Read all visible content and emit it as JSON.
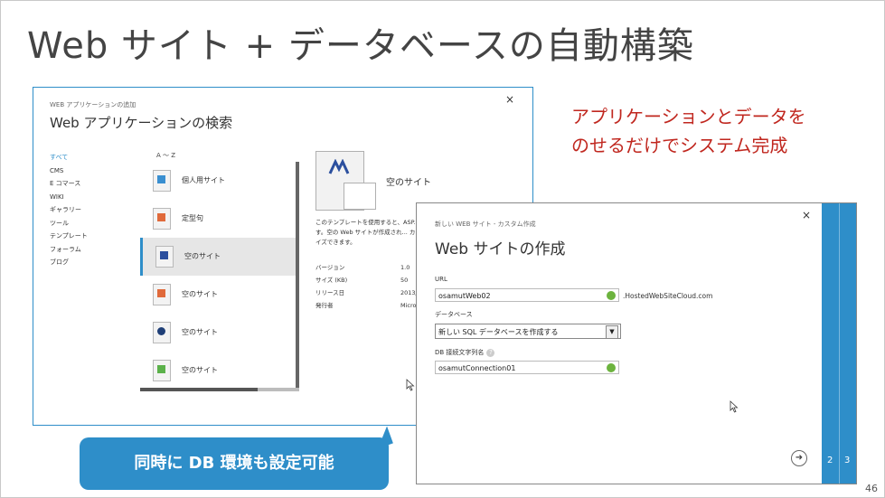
{
  "slide": {
    "title": "Web サイト + データベースの自動構築",
    "note_line1": "アプリケーションとデータを",
    "note_line2": "のせるだけでシステム完成",
    "callout": "同時に DB 環境も設定可能",
    "page_number": "46"
  },
  "gallery_dialog": {
    "close": "×",
    "breadcrumb": "WEB アプリケーションの追加",
    "title": "Web アプリケーションの検索",
    "categories": [
      "すべて",
      "CMS",
      "E コマース",
      "WIKI",
      "ギャラリー",
      "ツール",
      "テンプレート",
      "フォーラム",
      "ブログ"
    ],
    "az_label": "A ～ Z",
    "apps": [
      {
        "label": "個人用サイト"
      },
      {
        "label": "定型句"
      },
      {
        "label": "空のサイト"
      },
      {
        "label": "空のサイト"
      },
      {
        "label": "空のサイト"
      },
      {
        "label": "空のサイト"
      }
    ],
    "detail": {
      "name": "空のサイト",
      "description": "このテンプレートを使用すると、ASP... きます。空の Web サイトが作成され... カスタマイズできます。",
      "props": [
        {
          "key": "バージョン",
          "value": "1.0"
        },
        {
          "key": "サイズ (KB)",
          "value": "50"
        },
        {
          "key": "リリース日",
          "value": "2013/"
        },
        {
          "key": "発行者",
          "value": "Micro"
        }
      ]
    }
  },
  "create_dialog": {
    "close": "×",
    "breadcrumb": "新しい WEB サイト - カスタム作成",
    "title": "Web サイトの作成",
    "url_label": "URL",
    "url_value": "osamutWeb02",
    "url_suffix": ".HostedWebSiteCloud.com",
    "db_label": "データベース",
    "db_value": "新しい SQL データベースを作成する",
    "conn_label": "DB 接続文字列名",
    "conn_value": "osamutConnection01",
    "steps": [
      "2",
      "3"
    ]
  },
  "colors": {
    "accent": "#2e8ec9",
    "note_red": "#c0271f",
    "ok_green": "#6cb33e"
  }
}
